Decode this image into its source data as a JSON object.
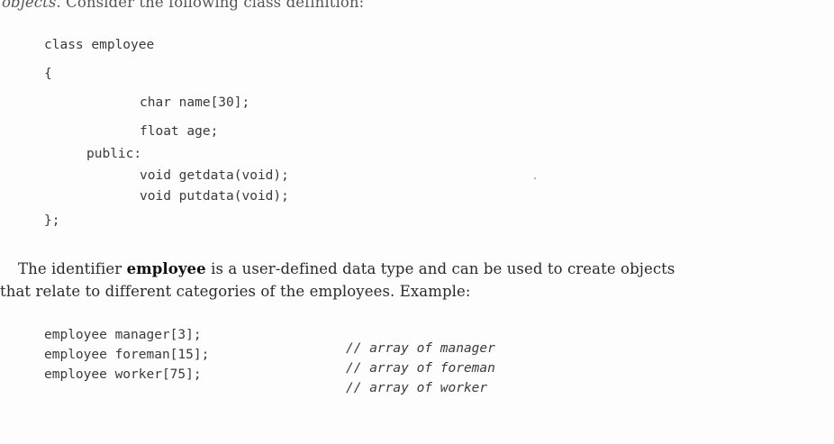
{
  "intro_text": {
    "italic_part": "objects.",
    "rest": " Consider the following class definition:"
  },
  "class_code": [
    "class employee",
    "{",
    "char name[30];",
    "float age;",
    "public:",
    "void getdata(void);",
    "void putdata(void);",
    "};"
  ],
  "paragraph": {
    "pre": "The identifier ",
    "bold": "employee",
    "post": " is a user-defined data type and can be used to create objects",
    "line2": "that relate to different categories of the employees. Example:"
  },
  "example_code": [
    {
      "code": "employee manager[3];",
      "comment": "// array of manager"
    },
    {
      "code": "employee foreman[15];",
      "comment": "// array of foreman"
    },
    {
      "code": "employee worker[75];",
      "comment": "// array of worker"
    }
  ]
}
